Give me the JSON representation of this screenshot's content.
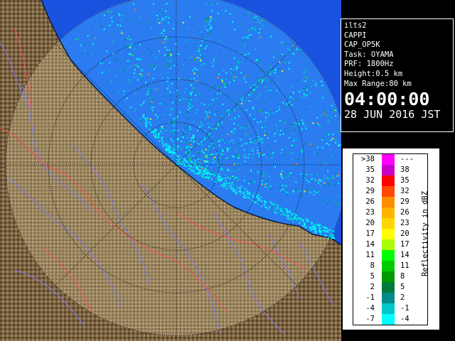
{
  "info": {
    "station": "ilts2",
    "product": "CAPPI",
    "product_code": "CAP_OP5K",
    "task": "Task: OYAMA",
    "prf": "PRF: 1800Hz",
    "height": "Height:0.5 km",
    "max_range": "Max Range:80 km",
    "time": "04:00:00",
    "date": "28 JUN 2016 JST"
  },
  "legend": {
    "title": "Reflectivity in dBZ",
    "rows": [
      {
        "low": ">38",
        "high": "---",
        "color": "#ff00ff"
      },
      {
        "low": "35",
        "high": "38",
        "color": "#c800c8"
      },
      {
        "low": "32",
        "high": "35",
        "color": "#ff0000"
      },
      {
        "low": "29",
        "high": "32",
        "color": "#ff4a00"
      },
      {
        "low": "26",
        "high": "29",
        "color": "#ff8c00"
      },
      {
        "low": "23",
        "high": "26",
        "color": "#ffb400"
      },
      {
        "low": "20",
        "high": "23",
        "color": "#ffd700"
      },
      {
        "low": "17",
        "high": "20",
        "color": "#ffff00"
      },
      {
        "low": "14",
        "high": "17",
        "color": "#aaff00"
      },
      {
        "low": "11",
        "high": "14",
        "color": "#00ff00"
      },
      {
        "low": "8",
        "high": "11",
        "color": "#00cc00"
      },
      {
        "low": "5",
        "high": "8",
        "color": "#009a00"
      },
      {
        "low": "2",
        "high": "5",
        "color": "#007a3a"
      },
      {
        "low": "-1",
        "high": "2",
        "color": "#008a8a"
      },
      {
        "low": "-4",
        "high": "-1",
        "color": "#00c8c8"
      },
      {
        "low": "-7",
        "high": "-4",
        "color": "#00ffff"
      }
    ]
  },
  "colors": {
    "sea": "#1a52e0",
    "radar_cover": "#2a7cf0",
    "land": "#7a6240",
    "land_light": "#b09a70",
    "river": "#7a7aff",
    "border": "#ff5050"
  },
  "map_icons": [
    "radar-sweep",
    "range-rings",
    "coastline",
    "rivers"
  ]
}
